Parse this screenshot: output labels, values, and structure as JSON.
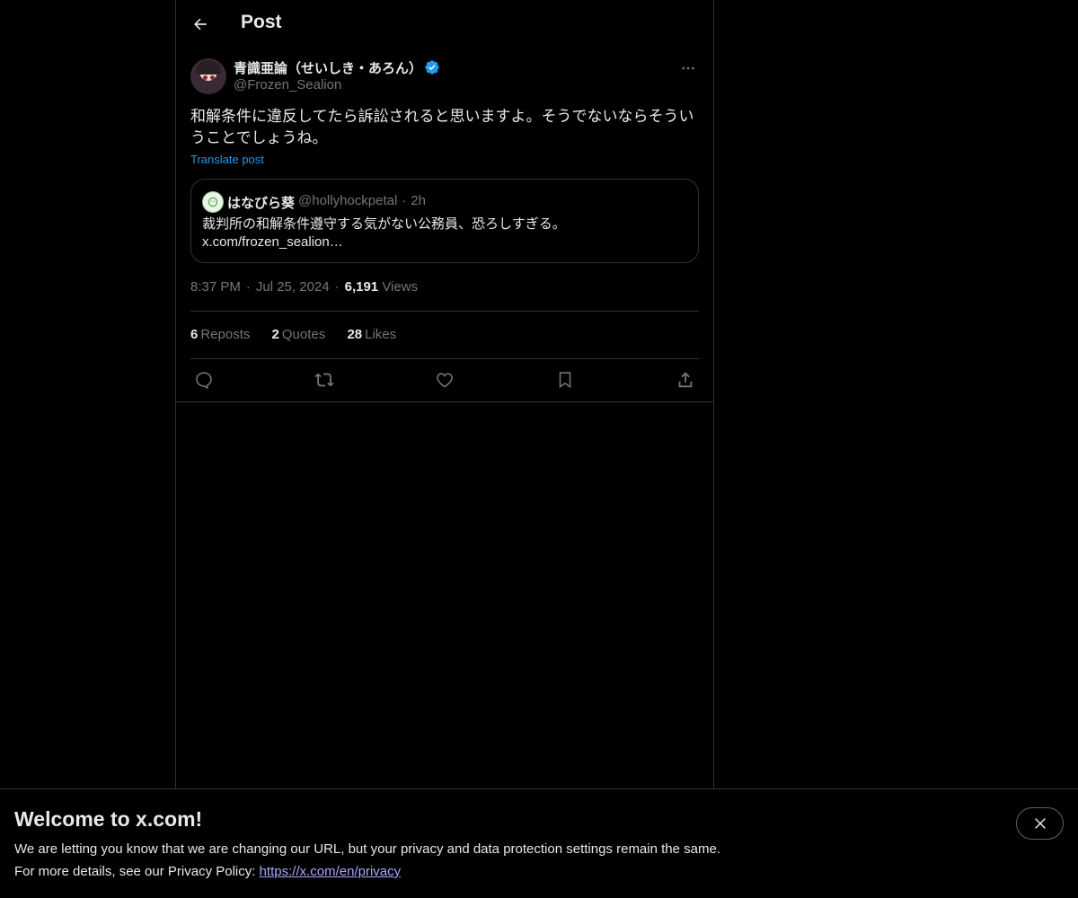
{
  "header": {
    "title": "Post"
  },
  "post": {
    "display_name": "青識亜論（せいしき・あろん）",
    "handle": "@Frozen_Sealion",
    "text": "和解条件に違反してたら訴訟されると思いますよ。そうでないならそういうことでしょうね。",
    "translate_label": "Translate post",
    "time": "8:37 PM",
    "date": "Jul 25, 2024",
    "views_count": "6,191",
    "views_label": "Views"
  },
  "quote": {
    "name": "はなびら葵",
    "handle": "@hollyhockpetal",
    "age": "2h",
    "text_line1": "裁判所の和解条件遵守する気がない公務員、恐ろしすぎる。",
    "text_line2": "x.com/frozen_sealion…"
  },
  "stats": {
    "reposts_count": "6",
    "reposts_label": "Reposts",
    "quotes_count": "2",
    "quotes_label": "Quotes",
    "likes_count": "28",
    "likes_label": "Likes"
  },
  "banner": {
    "title": "Welcome to x.com!",
    "line1": "We are letting you know that we are changing our URL, but your privacy and data protection settings remain the same.",
    "line2_prefix": "For more details, see our Privacy Policy: ",
    "link": "https://x.com/en/privacy"
  },
  "icons": [
    "back-arrow-icon",
    "verified-badge-icon",
    "more-icon",
    "reply-icon",
    "repost-icon",
    "like-icon",
    "bookmark-icon",
    "share-icon",
    "close-icon"
  ],
  "colors": {
    "background": "#000000",
    "text": "#e7e9ea",
    "muted": "#71767b",
    "link": "#1d9bf0",
    "border": "#2f3336"
  }
}
